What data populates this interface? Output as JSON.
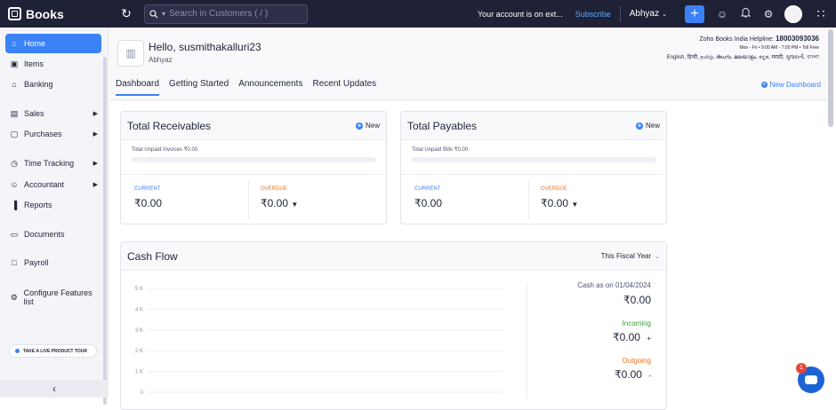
{
  "app": {
    "name": "Books"
  },
  "topbar": {
    "search_placeholder": "Search in Customers ( / )",
    "notice": "Your account is on ext...",
    "subscribe": "Subscribe",
    "org": "Abhyaz"
  },
  "sidebar": {
    "items": [
      {
        "label": "Home",
        "icon": "home-icon",
        "active": true,
        "arrow": false
      },
      {
        "label": "Items",
        "icon": "box-icon",
        "active": false,
        "arrow": false
      },
      {
        "label": "Banking",
        "icon": "bank-icon",
        "active": false,
        "arrow": false
      },
      {
        "label": "Sales",
        "icon": "cart-icon",
        "active": false,
        "arrow": true
      },
      {
        "label": "Purchases",
        "icon": "bag-icon",
        "active": false,
        "arrow": true
      },
      {
        "label": "Time Tracking",
        "icon": "clock-icon",
        "active": false,
        "arrow": true
      },
      {
        "label": "Accountant",
        "icon": "person-icon",
        "active": false,
        "arrow": true
      },
      {
        "label": "Reports",
        "icon": "chart-icon",
        "active": false,
        "arrow": false
      },
      {
        "label": "Documents",
        "icon": "folder-icon",
        "active": false,
        "arrow": false
      },
      {
        "label": "Payroll",
        "icon": "payroll-icon",
        "active": false,
        "arrow": false
      },
      {
        "label": "Configure Features list",
        "icon": "settings-icon",
        "active": false,
        "arrow": false
      }
    ],
    "tour": "TAKE A LIVE PRODUCT TOUR"
  },
  "header": {
    "greeting": "Hello, susmithakalluri23",
    "org": "Abhyaz",
    "helpline_label": "Zoho Books India Helpline:",
    "helpline_number": "18003093036",
    "hours": "Mon - Fri • 9:00 AM - 7:00 PM • Toll Free",
    "languages": "English, हिन्दी, தமிழ், తెలుగు, മലയാളം, ಕನ್ನಡ, मराठी, ગુજરાતી, বাংলা",
    "tabs": [
      "Dashboard",
      "Getting Started",
      "Announcements",
      "Recent Updates"
    ],
    "new_dashboard": "New Dashboard"
  },
  "receivables": {
    "title": "Total Receivables",
    "new": "New",
    "unpaid": "Total Unpaid Invoices ₹0.00",
    "progress": 0,
    "current_label": "CURRENT",
    "current_value": "₹0.00",
    "overdue_label": "OVERDUE",
    "overdue_value": "₹0.00"
  },
  "payables": {
    "title": "Total Payables",
    "new": "New",
    "unpaid": "Total Unpaid Bills ₹0.00",
    "progress": 0,
    "current_label": "CURRENT",
    "current_value": "₹0.00",
    "overdue_label": "OVERDUE",
    "overdue_value": "₹0.00"
  },
  "cashflow": {
    "title": "Cash Flow",
    "period": "This Fiscal Year",
    "cash_as_on": "Cash as on 01/04/2024",
    "cash_value": "₹0.00",
    "incoming_label": "Incoming",
    "incoming_value": "₹0.00",
    "incoming_sign": "+",
    "outgoing_label": "Outgoing",
    "outgoing_value": "₹0.00",
    "outgoing_sign": "-"
  },
  "chart_data": {
    "type": "line",
    "yticks": [
      "5 K",
      "4 K",
      "3 K",
      "2 K",
      "1 K",
      "0"
    ],
    "ylim": [
      0,
      5000
    ],
    "series": []
  },
  "chat": {
    "badge": "1"
  },
  "colors": {
    "accent": "#3b82f6",
    "topbar": "#1f2136",
    "overdue": "#f0731f",
    "incoming": "#3c9a3c",
    "outgoing": "#f0731f"
  }
}
